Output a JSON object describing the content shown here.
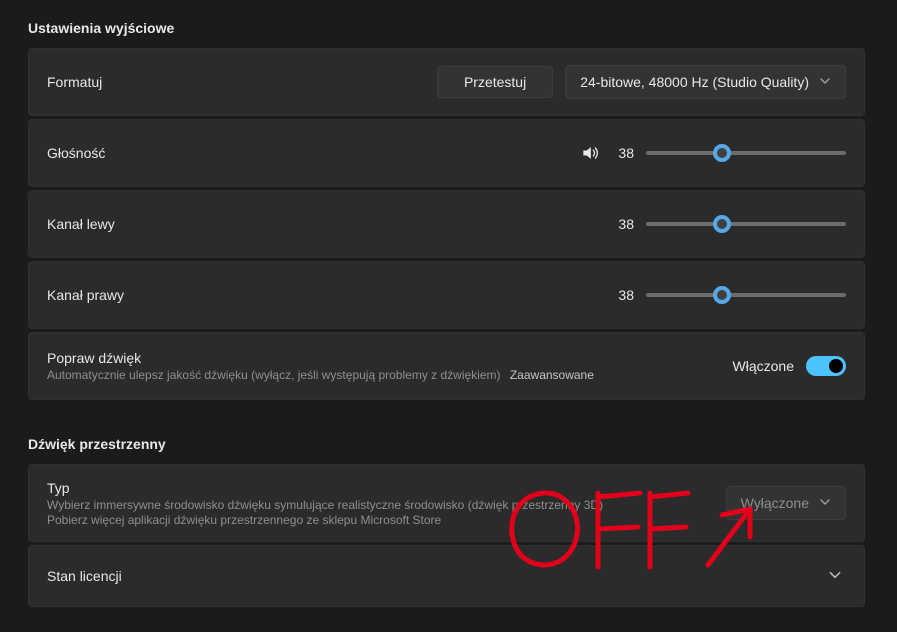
{
  "sections": {
    "output": {
      "title": "Ustawienia wyjściowe",
      "format": {
        "label": "Formatuj",
        "test_button": "Przetestuj",
        "value": "24-bitowe, 48000 Hz (Studio Quality)"
      },
      "volume": {
        "label": "Głośność",
        "value": "38",
        "percent": 38
      },
      "left": {
        "label": "Kanał lewy",
        "value": "38",
        "percent": 38
      },
      "right": {
        "label": "Kanał prawy",
        "value": "38",
        "percent": 38
      },
      "enhance": {
        "label": "Popraw dźwięk",
        "sub": "Automatycznie ulepsz jakość dźwięku (wyłącz, jeśli występują problemy z dźwiękiem)",
        "advanced": "Zaawansowane",
        "state": "Włączone"
      }
    },
    "spatial": {
      "title": "Dźwięk przestrzenny",
      "type": {
        "label": "Typ",
        "sub": "Wybierz immersywne środowisko dźwięku symulujące realistyczne środowisko (dźwięk przestrzenny 3D)",
        "sub2": "Pobierz więcej aplikacji dźwięku przestrzennego ze sklepu Microsoft Store",
        "value": "Wyłączone"
      },
      "license": {
        "label": "Stan licencji"
      }
    }
  },
  "annotation_text": "OFF"
}
